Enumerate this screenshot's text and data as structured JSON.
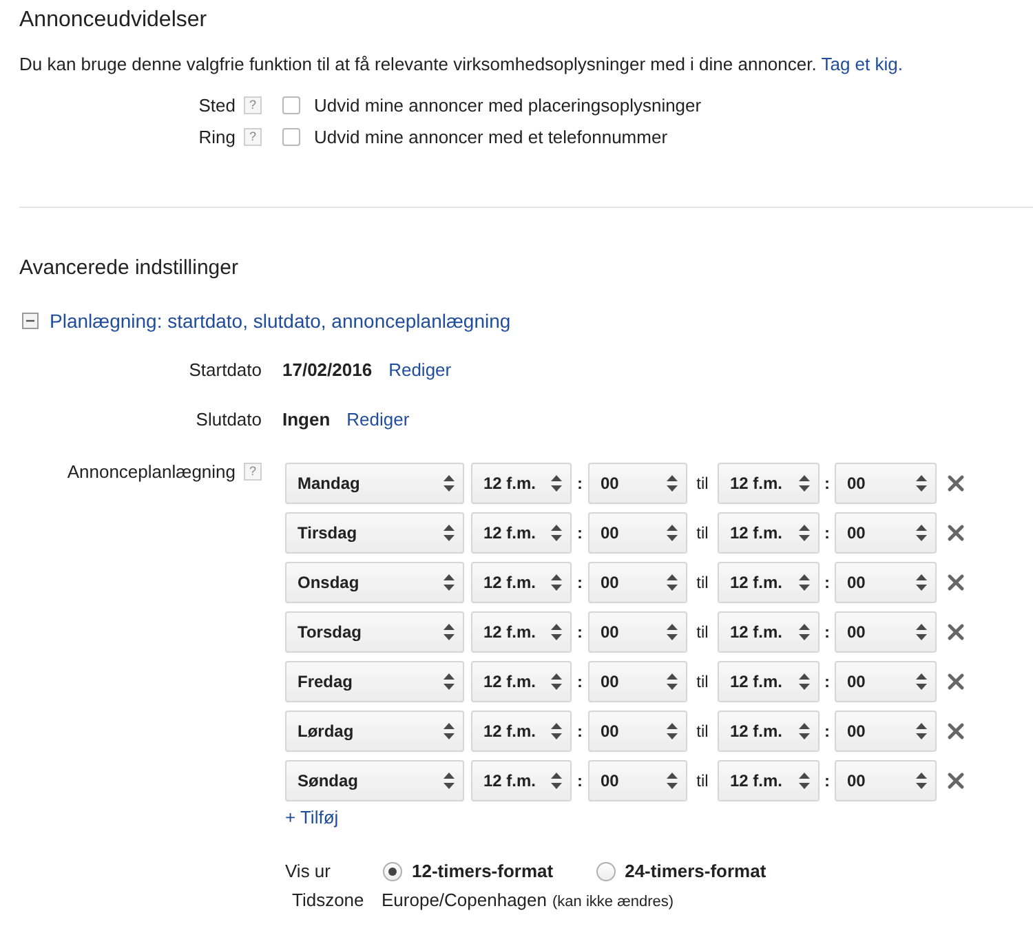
{
  "extensions": {
    "title": "Annonceudvidelser",
    "description": "Du kan bruge denne valgfrie funktion til at få relevante virksomhedsoplysninger med i dine annoncer.",
    "link": "Tag et kig.",
    "options": [
      {
        "label": "Sted",
        "help": "?",
        "checked": false,
        "text": "Udvid mine annoncer med placeringsoplysninger"
      },
      {
        "label": "Ring",
        "help": "?",
        "checked": false,
        "text": "Udvid mine annoncer med et telefonnummer"
      }
    ]
  },
  "advanced": {
    "title": "Avancerede indstillinger",
    "section": {
      "expanded": true,
      "link": "Planlægning: startdato, slutdato, annonceplanlægning"
    },
    "dates": [
      {
        "label": "Startdato",
        "value": "17/02/2016",
        "action": "Rediger"
      },
      {
        "label": "Slutdato",
        "value": "Ingen",
        "action": "Rediger"
      }
    ],
    "schedule": {
      "label": "Annonceplanlægning",
      "help": "?",
      "rows": [
        {
          "day": "Mandag",
          "from_hour": "12 f.m.",
          "colon_1": ":",
          "from_minute": "00",
          "to": "til",
          "to_hour": "12 f.m.",
          "colon_2": ":",
          "to_minute": "00"
        },
        {
          "day": "Tirsdag",
          "from_hour": "12 f.m.",
          "colon_1": ":",
          "from_minute": "00",
          "to": "til",
          "to_hour": "12 f.m.",
          "colon_2": ":",
          "to_minute": "00"
        },
        {
          "day": "Onsdag",
          "from_hour": "12 f.m.",
          "colon_1": ":",
          "from_minute": "00",
          "to": "til",
          "to_hour": "12 f.m.",
          "colon_2": ":",
          "to_minute": "00"
        },
        {
          "day": "Torsdag",
          "from_hour": "12 f.m.",
          "colon_1": ":",
          "from_minute": "00",
          "to": "til",
          "to_hour": "12 f.m.",
          "colon_2": ":",
          "to_minute": "00"
        },
        {
          "day": "Fredag",
          "from_hour": "12 f.m.",
          "colon_1": ":",
          "from_minute": "00",
          "to": "til",
          "to_hour": "12 f.m.",
          "colon_2": ":",
          "to_minute": "00"
        },
        {
          "day": "Lørdag",
          "from_hour": "12 f.m.",
          "colon_1": ":",
          "from_minute": "00",
          "to": "til",
          "to_hour": "12 f.m.",
          "colon_2": ":",
          "to_minute": "00"
        },
        {
          "day": "Søndag",
          "from_hour": "12 f.m.",
          "colon_1": ":",
          "from_minute": "00",
          "to": "til",
          "to_hour": "12 f.m.",
          "colon_2": ":",
          "to_minute": "00"
        }
      ],
      "add": "+ Tilføj"
    },
    "clock": {
      "label": "Vis ur",
      "options": [
        {
          "label": "12-timers-format",
          "selected": true
        },
        {
          "label": "24-timers-format",
          "selected": false
        }
      ]
    },
    "timezone": {
      "label": "Tidszone",
      "value": "Europe/Copenhagen",
      "note": "(kan ikke ændres)"
    }
  }
}
